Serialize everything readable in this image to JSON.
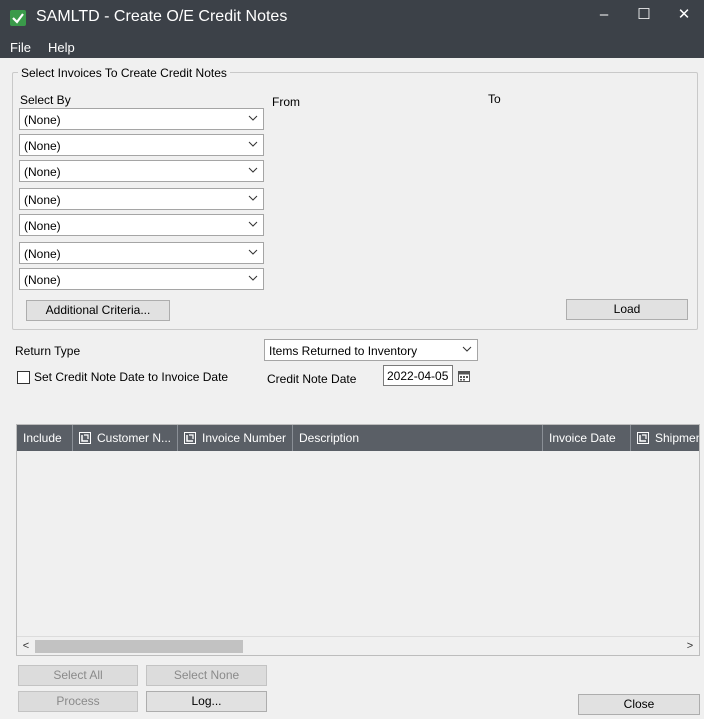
{
  "window": {
    "title": "SAMLTD - Create O/E Credit Notes",
    "minimize": "–",
    "maximize": "☐",
    "close": "✕"
  },
  "menu": {
    "items": [
      "File",
      "Help"
    ]
  },
  "selection": {
    "group_title": "Select Invoices To Create Credit Notes",
    "select_by_label": "Select By",
    "from_label": "From",
    "to_label": "To",
    "criteria": [
      "(None)",
      "(None)",
      "(None)",
      "(None)",
      "(None)",
      "(None)",
      "(None)"
    ],
    "additional_criteria_button": "Additional Criteria...",
    "load_button": "Load"
  },
  "options": {
    "return_type_label": "Return Type",
    "return_type_value": "Items Returned to Inventory",
    "set_date_checkbox_label": "Set Credit Note Date to Invoice Date",
    "set_date_checked": false,
    "credit_note_date_label": "Credit Note Date",
    "credit_note_date_value": "2022-04-05"
  },
  "grid": {
    "columns": [
      {
        "label": "Include",
        "icon": false
      },
      {
        "label": "Customer N...",
        "icon": true
      },
      {
        "label": "Invoice Number",
        "icon": true
      },
      {
        "label": "Description",
        "icon": false
      },
      {
        "label": "Invoice Date",
        "icon": false
      },
      {
        "label": "Shipmen",
        "icon": true
      }
    ],
    "header_color": "#5a5f66",
    "rows": []
  },
  "buttons": {
    "select_all": "Select All",
    "select_none": "Select None",
    "process": "Process",
    "log": "Log...",
    "close": "Close"
  },
  "icons": {
    "app": "app-check-icon",
    "calendar": "calendar-icon",
    "dropdown": "chevron-down-icon",
    "column_filter": "column-filter-icon"
  }
}
